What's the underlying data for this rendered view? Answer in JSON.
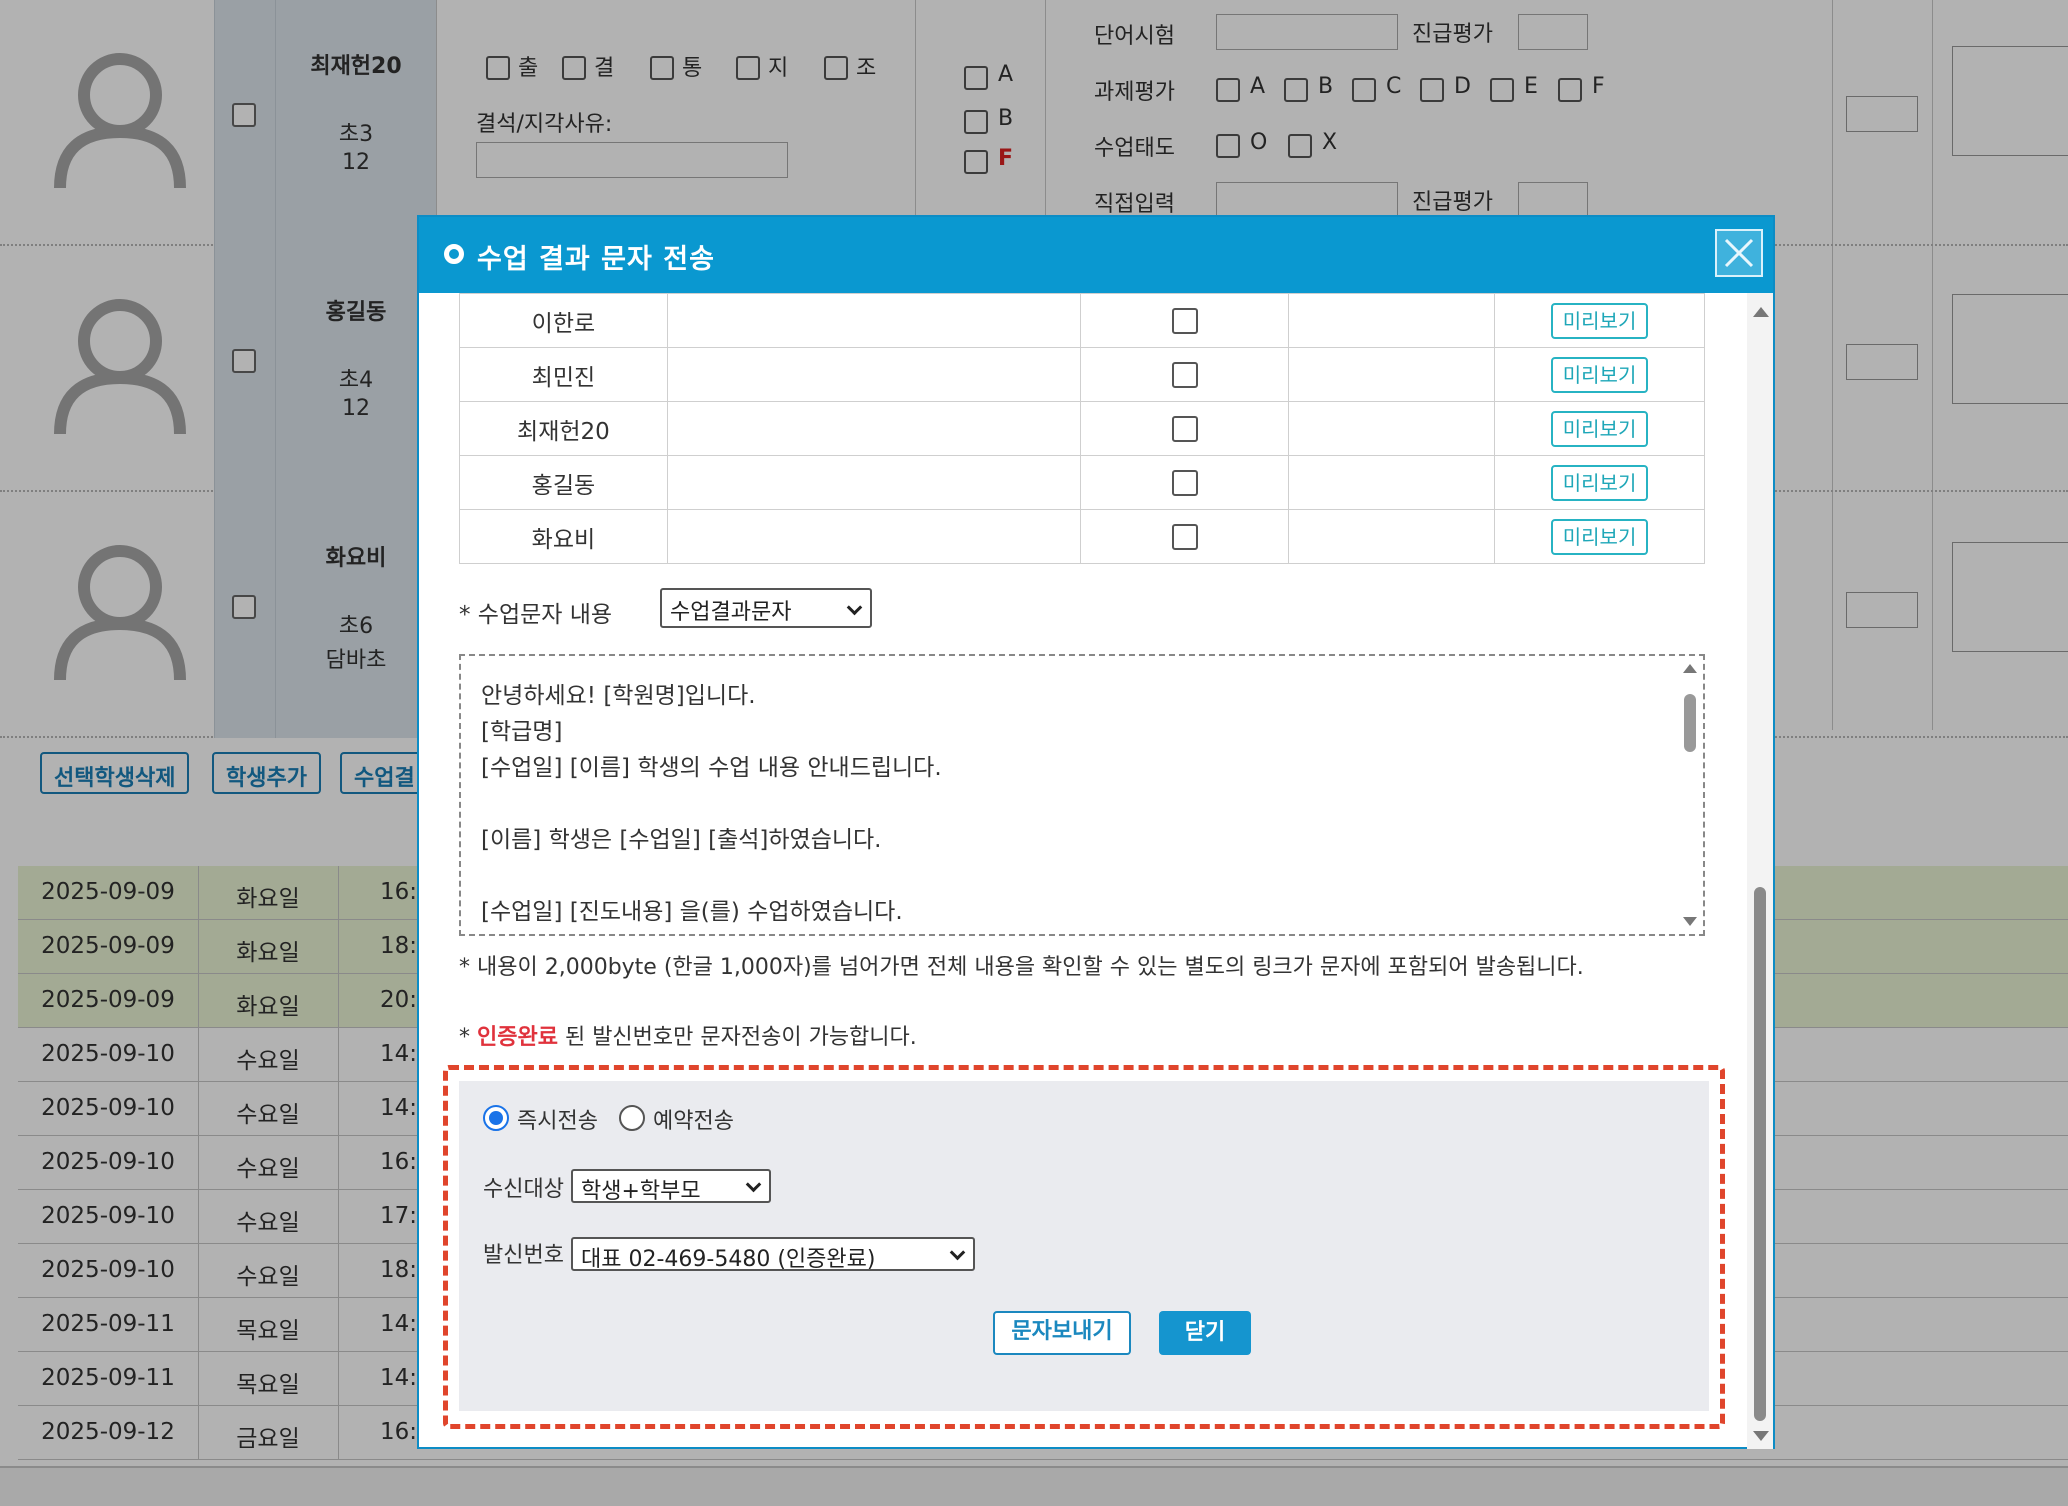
{
  "background": {
    "students": [
      {
        "name": "최재헌20",
        "grade": "초3",
        "school": "12"
      },
      {
        "name": "홍길동",
        "grade": "초4",
        "school": "12"
      },
      {
        "name": "화요비",
        "grade": "초6",
        "school": "담바초"
      }
    ],
    "attendance": [
      "출",
      "결",
      "통",
      "지",
      "조"
    ],
    "absence_reason_label": "결석/지각사유:",
    "grade_options": [
      "A",
      "B",
      "F"
    ],
    "word_test_label": "단어시험",
    "homework_label": "과제평가",
    "homework_options": [
      "A",
      "B",
      "C",
      "D",
      "E",
      "F"
    ],
    "attitude_label": "수업태도",
    "attitude_options": [
      "O",
      "X"
    ],
    "direct_input_label": "직접입력",
    "rank_label": "진급평가",
    "buttons": {
      "delete_selected": "선택학생삭제",
      "add_student": "학생추가",
      "class_result": "수업결"
    },
    "schedule": [
      {
        "date": "2025-09-09",
        "day": "화요일",
        "time": "16:",
        "highlight": true
      },
      {
        "date": "2025-09-09",
        "day": "화요일",
        "time": "18:",
        "highlight": true
      },
      {
        "date": "2025-09-09",
        "day": "화요일",
        "time": "20:",
        "highlight": true
      },
      {
        "date": "2025-09-10",
        "day": "수요일",
        "time": "14:",
        "highlight": false
      },
      {
        "date": "2025-09-10",
        "day": "수요일",
        "time": "14:",
        "highlight": false
      },
      {
        "date": "2025-09-10",
        "day": "수요일",
        "time": "16:",
        "highlight": false
      },
      {
        "date": "2025-09-10",
        "day": "수요일",
        "time": "17:",
        "highlight": false
      },
      {
        "date": "2025-09-10",
        "day": "수요일",
        "time": "18:",
        "highlight": false
      },
      {
        "date": "2025-09-11",
        "day": "목요일",
        "time": "14:",
        "highlight": false
      },
      {
        "date": "2025-09-11",
        "day": "목요일",
        "time": "14:",
        "highlight": false
      },
      {
        "date": "2025-09-12",
        "day": "금요일",
        "time": "16:",
        "highlight": false
      }
    ]
  },
  "modal": {
    "title": "수업 결과 문자 전송",
    "recipients": [
      {
        "name": "이한로",
        "preview": "미리보기"
      },
      {
        "name": "최민진",
        "preview": "미리보기"
      },
      {
        "name": "최재헌20",
        "preview": "미리보기"
      },
      {
        "name": "홍길동",
        "preview": "미리보기"
      },
      {
        "name": "화요비",
        "preview": "미리보기"
      }
    ],
    "content_label": "* 수업문자 내용",
    "content_select": "수업결과문자",
    "message_text": "안녕하세요! [학원명]입니다.\n[학급명]\n[수업일] [이름] 학생의 수업 내용 안내드립니다.\n\n[이름] 학생은 [수업일] [출석]하였습니다.\n\n[수업일] [진도내용] 을(를) 수업하였습니다.",
    "note_length": "* 내용이 2,000byte (한글 1,000자)를 넘어가면 전체 내용을 확인할 수 있는 별도의 링크가 문자에 포함되어 발송됩니다.",
    "note_auth_prefix": "* ",
    "note_auth_red": "인증완료",
    "note_auth_suffix": " 된 발신번호만 문자전송이 가능합니다.",
    "send_mode_immediate": "즉시전송",
    "send_mode_scheduled": "예약전송",
    "recipient_label": "수신대상",
    "recipient_value": "학생+학부모",
    "sender_label": "발신번호",
    "sender_value": "대표 02-469-5480 (인증완료)",
    "send_button": "문자보내기",
    "close_button": "닫기"
  }
}
